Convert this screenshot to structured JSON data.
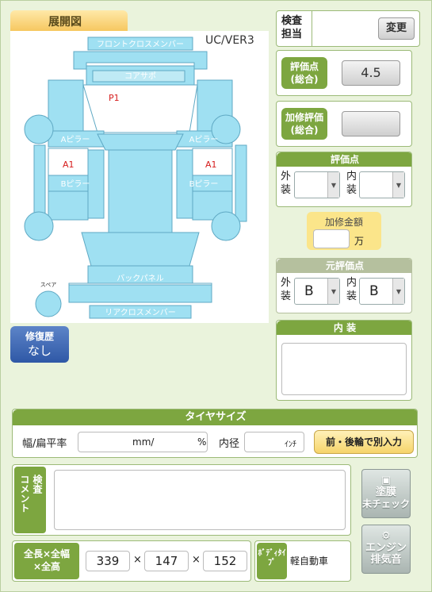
{
  "diagram": {
    "tab_title": "展開図",
    "version": "UC/VER3",
    "labels": {
      "front_cross_member": "フロントクロスメンバー",
      "core_support": "コアサポ",
      "p1": "P1",
      "a_pillar_left": "Aピラー",
      "a_pillar_right": "Aピラー",
      "a1_left": "A1",
      "a1_right": "A1",
      "b_pillar_left": "Bピラー",
      "b_pillar_right": "Bピラー",
      "back_panel": "バックパネル",
      "rear_cross_member": "リアクロスメンバー",
      "spare": "スペア"
    }
  },
  "repair_history": {
    "label": "修復歴",
    "value": "なし"
  },
  "inspector": {
    "label_line1": "検査",
    "label_line2": "担当",
    "change_button": "変更"
  },
  "rating_total": {
    "label_line1": "評価点",
    "label_line2": "(総合)",
    "value": "4.5"
  },
  "extra_rating": {
    "label_line1": "加修評価",
    "label_line2": "(総合)",
    "value": ""
  },
  "rating_section": {
    "header": "評価点",
    "exterior_label1": "外",
    "exterior_label2": "装",
    "exterior_value": "",
    "interior_label1": "内",
    "interior_label2": "装",
    "interior_value": ""
  },
  "repair_amount": {
    "label": "加修金額",
    "value": "",
    "unit": "万"
  },
  "original_rating": {
    "header": "元評価点",
    "exterior_label1": "外",
    "exterior_label2": "装",
    "exterior_value": "B",
    "interior_label1": "内",
    "interior_label2": "装",
    "interior_value": "B"
  },
  "interior_section": {
    "header": "内 装",
    "value": ""
  },
  "tire": {
    "header": "タイヤサイズ",
    "width_label": "幅/扁平率",
    "mm_unit": "mm/",
    "percent_unit": "%",
    "inner_label": "内径",
    "inch_unit": "ｲﾝﾁ",
    "separate_button": "前・後輪で別入力"
  },
  "comment": {
    "label": "コメント",
    "label2": "検査",
    "value": ""
  },
  "paint_button": {
    "line1": "塗膜",
    "line2": "未チェック"
  },
  "engine_button": {
    "line1": "エンジン",
    "line2": "排気音"
  },
  "dimensions": {
    "label_line1": "全長×全幅",
    "label_line2": "×全高",
    "length": "339",
    "width": "147",
    "height": "152",
    "sep": "×"
  },
  "body_type": {
    "label": "ﾎﾞﾃﾞｨﾀｲﾌﾟ",
    "value": "軽自動車"
  }
}
